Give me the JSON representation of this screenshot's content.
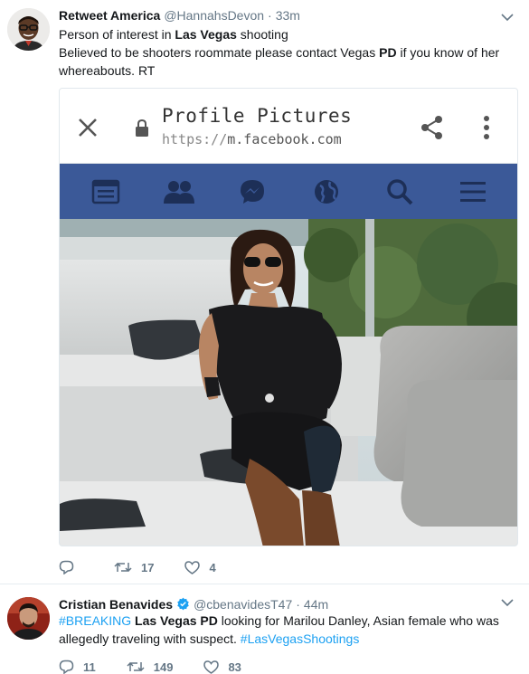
{
  "tweet1": {
    "name": "Retweet America",
    "handle": "@HannahsDevon",
    "separator": "·",
    "time": "33m",
    "text_parts": {
      "p1": "Person of interest in ",
      "p2": "Las Vegas",
      "p3": " shooting",
      "p4": "Believed to be shooters roommate please contact Vegas ",
      "p5": "PD",
      "p6": " if you know of her whereabouts. RT"
    },
    "media": {
      "page_title": "Profile Pictures",
      "url_scheme": "https://",
      "url_host": "m.facebook.com",
      "nav_icons": [
        "news-feed-icon",
        "friends-icon",
        "messenger-icon",
        "globe-icon",
        "search-icon",
        "menu-icon"
      ]
    },
    "actions": {
      "reply_count": "",
      "retweet_count": "17",
      "like_count": "4"
    }
  },
  "tweet2": {
    "name": "Cristian Benavides",
    "handle": "@cbenavidesT47",
    "separator": "·",
    "time": "44m",
    "text_parts": {
      "hashtag1": "#BREAKING",
      "p1": " ",
      "p2": "Las Vegas PD",
      "p3": " looking for Marilou Danley, Asian female who was allegedly traveling with suspect. ",
      "hashtag2": "#LasVegasShootings"
    },
    "actions": {
      "reply_count": "11",
      "retweet_count": "149",
      "like_count": "83"
    }
  },
  "colors": {
    "link": "#1da1f2",
    "muted": "#657786",
    "facebook_blue": "#3b5998",
    "verified": "#1da1f2"
  }
}
